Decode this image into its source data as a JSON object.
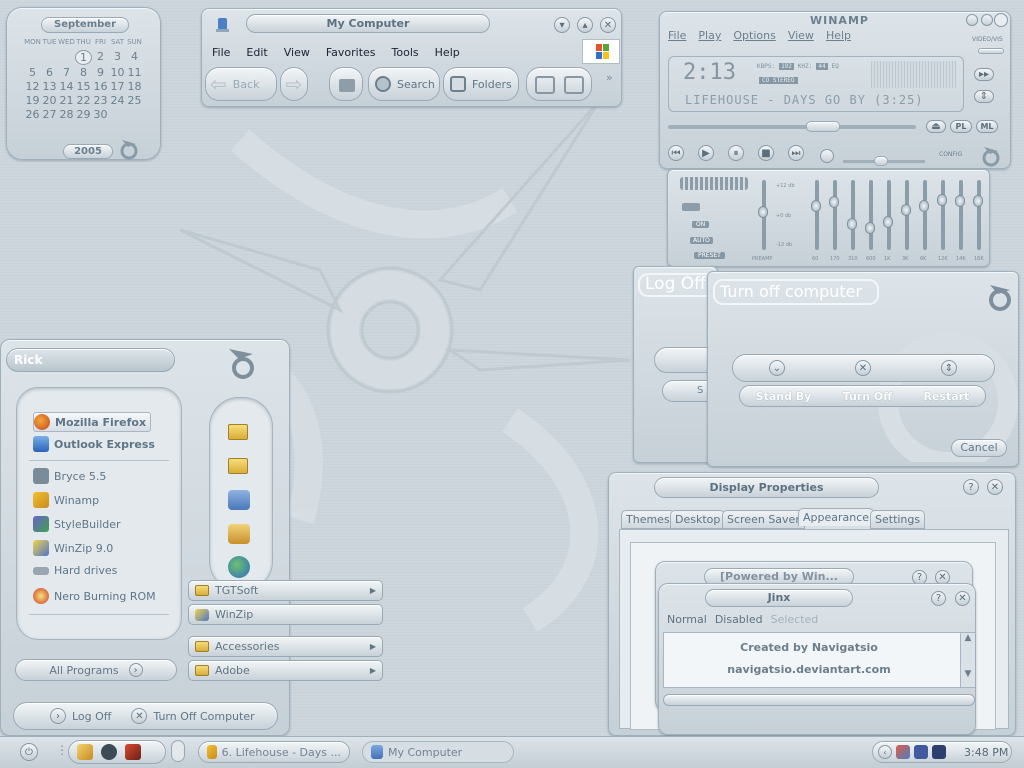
{
  "calendar": {
    "month": "September",
    "weekdays": [
      "MON",
      "TUE",
      "WED",
      "THU",
      "FRI",
      "SAT",
      "SUN"
    ],
    "weeks": [
      [
        "",
        "",
        "",
        "1",
        "2",
        "3",
        "4"
      ],
      [
        "5",
        "6",
        "7",
        "8",
        "9",
        "10",
        "11"
      ],
      [
        "12",
        "13",
        "14",
        "15",
        "16",
        "17",
        "18"
      ],
      [
        "19",
        "20",
        "21",
        "22",
        "23",
        "24",
        "25"
      ],
      [
        "26",
        "27",
        "28",
        "29",
        "30",
        "",
        ""
      ]
    ],
    "year": "2005"
  },
  "explorer": {
    "title": "My Computer",
    "menu": [
      "File",
      "Edit",
      "View",
      "Favorites",
      "Tools",
      "Help"
    ],
    "back": "Back",
    "search": "Search",
    "folders": "Folders"
  },
  "winamp": {
    "title": "WINAMP",
    "menu": [
      "File",
      "Play",
      "Options",
      "View",
      "Help"
    ],
    "video_vis": "VIDEO/VIS",
    "time": "2:13",
    "kbps_label": "KBPS:",
    "kbps": "192",
    "khz_label": "KHZ:",
    "khz": "44",
    "eq_label": "EQ",
    "stereo": "CO STEREO",
    "song": "LIFEHOUSE - DAYS GO BY (3:25)",
    "pl": "PL",
    "ml": "ML",
    "config": "CONFIG",
    "eq_on": "ON",
    "eq_auto": "AUTO",
    "eq_preset": "PRESET",
    "db_top": "+12 db",
    "db_mid": "+0 db",
    "db_bot": "-12 db",
    "bands": [
      "PREAMP",
      "60",
      "170",
      "310",
      "600",
      "1K",
      "3K",
      "6K",
      "12K",
      "14K",
      "16K"
    ],
    "levels": [
      0.45,
      0.35,
      0.28,
      0.65,
      0.72,
      0.62,
      0.42,
      0.35,
      0.24,
      0.25,
      0.25
    ]
  },
  "logoff": {
    "title": "Log Off",
    "btn_partial": "S"
  },
  "turnoff": {
    "title": "Turn off computer",
    "standby": "Stand By",
    "turnoff": "Turn Off",
    "restart": "Restart",
    "cancel": "Cancel"
  },
  "startmenu": {
    "user": "Rick",
    "pinned": [
      "Mozilla Firefox",
      "Outlook Express"
    ],
    "recent": [
      "Bryce 5.5",
      "Winamp",
      "StyleBuilder",
      "WinZip 9.0",
      "Hard drives",
      "Nero Burning ROM"
    ],
    "all_programs": "All Programs",
    "logoff": "Log Off",
    "turnoff": "Turn Off Computer"
  },
  "submenu": {
    "top": [
      "TGTSoft",
      "WinZip"
    ],
    "bottom": [
      "Accessories",
      "Adobe"
    ]
  },
  "display": {
    "title": "Display Properties",
    "tabs": [
      "Themes",
      "Desktop",
      "Screen Saver",
      "Appearance",
      "Settings"
    ],
    "preview_title1": "[Powered by Win...",
    "preview_title2": "Jinx",
    "states": [
      "Normal",
      "Disabled",
      "Selected"
    ],
    "credit1": "Created by Navigatsio",
    "credit2": "navigatsio.deviantart.com"
  },
  "taskbar": {
    "task1": "6. Lifehouse - Days ...",
    "task2": "My Computer",
    "clock": "3:48 PM"
  }
}
